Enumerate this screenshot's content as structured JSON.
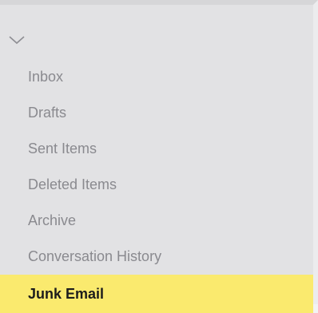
{
  "folders": {
    "collapse_icon": "chevron-down-icon",
    "items": [
      {
        "label": "Inbox",
        "selected": false
      },
      {
        "label": "Drafts",
        "selected": false
      },
      {
        "label": "Sent Items",
        "selected": false
      },
      {
        "label": "Deleted Items",
        "selected": false
      },
      {
        "label": "Archive",
        "selected": false
      },
      {
        "label": "Conversation History",
        "selected": false
      },
      {
        "label": "Junk Email",
        "selected": true
      }
    ]
  },
  "colors": {
    "panel_background": "#e2e2e4",
    "item_text": "#8a8a8f",
    "selected_background": "#faea6e",
    "selected_text": "#1c1c1c"
  }
}
